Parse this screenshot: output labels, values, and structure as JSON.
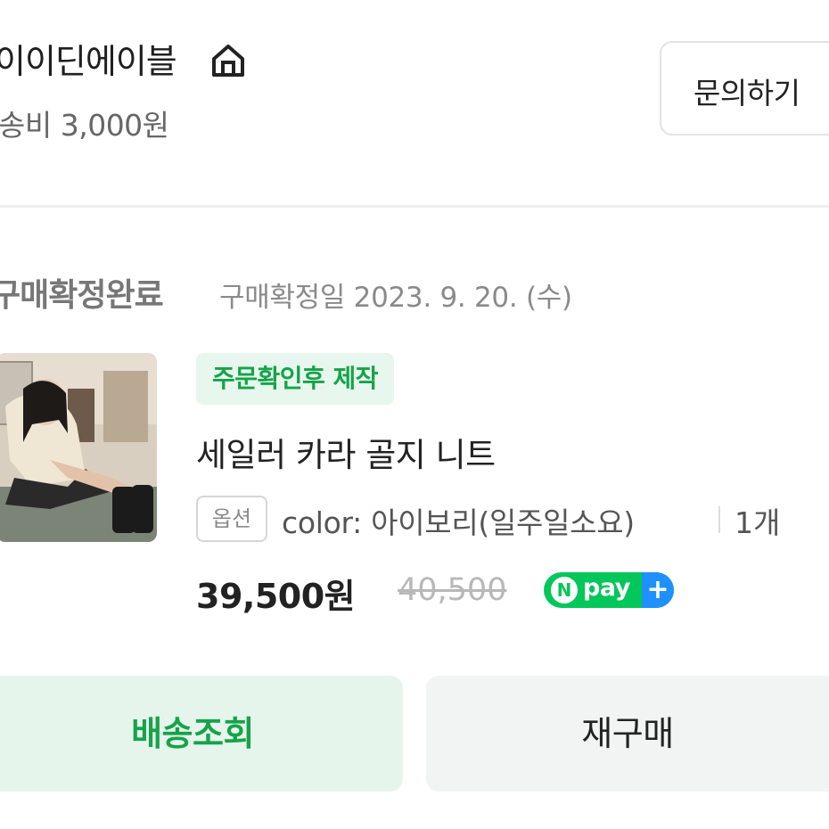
{
  "store": {
    "name": "이이딘에이블",
    "home_icon": "home-icon",
    "shipping_fee": "송비 3,000원",
    "inquiry_label": "문의하기"
  },
  "order": {
    "status": "구매확정완료",
    "confirm_date": "구매확정일 2023. 9. 20. (수)",
    "product": {
      "badge": "주문확인후 제작",
      "name": "세일러 카라 골지 니트",
      "option_label": "옵션",
      "option_value": "color: 아이보리(일주일소요)",
      "quantity": "1개",
      "price": "39,500원",
      "original_price": "40,500",
      "payment_badge": {
        "n": "N",
        "text": "pay",
        "plus": "+"
      }
    }
  },
  "actions": {
    "track_label": "배송조회",
    "rebuy_label": "재구매"
  },
  "colors": {
    "accent_green": "#16a34a",
    "badge_bg": "#e8f7ee",
    "npay_green": "#03c75a",
    "npay_blue": "#1e90ff"
  }
}
